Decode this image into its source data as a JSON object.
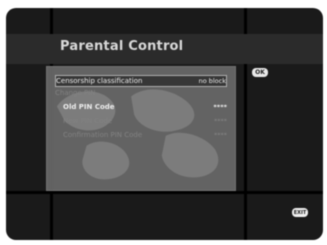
{
  "menu": {
    "title": "Parental Control",
    "items": [
      {
        "label": "Censorship classification",
        "value": "no block"
      },
      {
        "label": "Change PIN",
        "value": ""
      },
      {
        "label": "Old PIN Code",
        "value": "****"
      },
      {
        "label": "New PIN Code",
        "value": "****"
      },
      {
        "label": "Confirmation PIN Code",
        "value": "****"
      }
    ]
  },
  "hints": {
    "ok_badge": "OK",
    "exit_badge": "EXIT"
  },
  "colors": {
    "background": "#1a1a1a",
    "panel": "#6a6a6a",
    "selection": "#3a3a3a",
    "text": "#d8d8d8"
  }
}
